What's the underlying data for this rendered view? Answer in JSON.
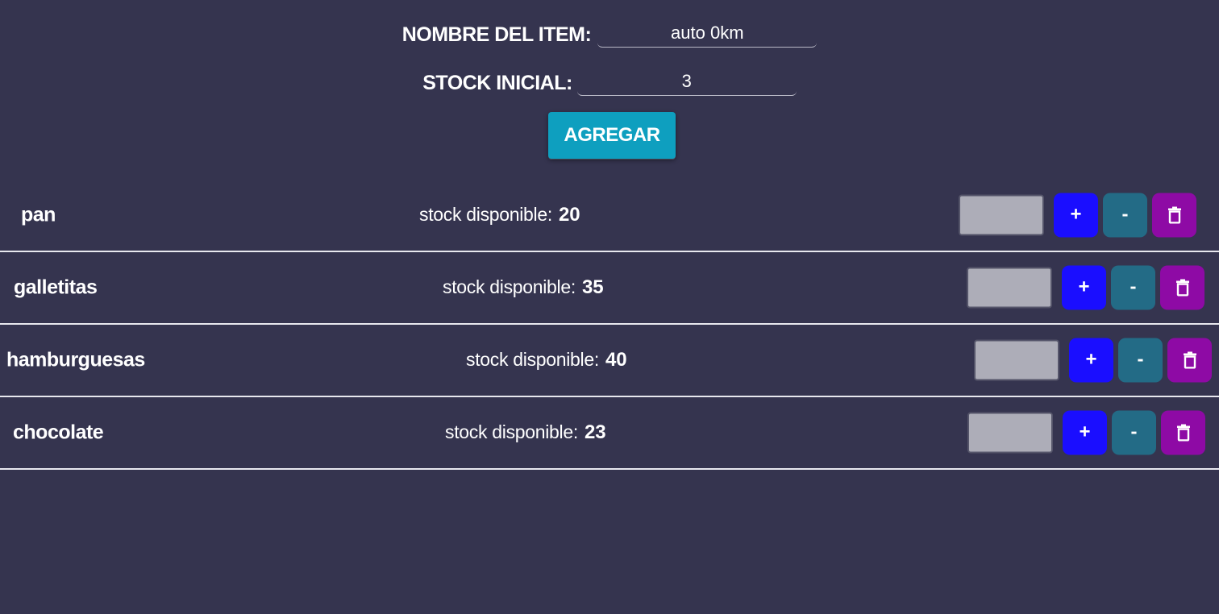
{
  "form": {
    "name_label": "NOMBRE DEL ITEM:",
    "name_value": "auto 0km",
    "stock_label": "STOCK INICIAL:",
    "stock_value": "3",
    "add_button": "AGREGAR"
  },
  "items": [
    {
      "name": "pan",
      "stock_label": "stock disponible:",
      "stock": "20",
      "qty_value": "",
      "plus_label": "+",
      "minus_label": "-",
      "delete_icon": "trash-icon"
    },
    {
      "name": "galletitas",
      "stock_label": "stock disponible:",
      "stock": "35",
      "qty_value": "",
      "plus_label": "+",
      "minus_label": "-",
      "delete_icon": "trash-icon"
    },
    {
      "name": "hamburguesas",
      "stock_label": "stock disponible:",
      "stock": "40",
      "qty_value": "",
      "plus_label": "+",
      "minus_label": "-",
      "delete_icon": "trash-icon"
    },
    {
      "name": "chocolate",
      "stock_label": "stock disponible:",
      "stock": "23",
      "qty_value": "",
      "plus_label": "+",
      "minus_label": "-",
      "delete_icon": "trash-icon"
    }
  ],
  "colors": {
    "background": "#35344f",
    "add_button": "#0e9fbf",
    "plus_button": "#1a0eff",
    "minus_button": "#236b86",
    "delete_button": "#8e0aa5",
    "qty_input": "#adadb8"
  }
}
